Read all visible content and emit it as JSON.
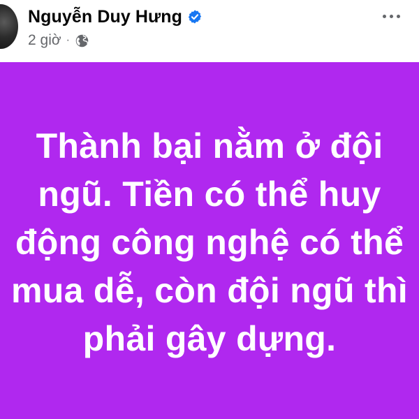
{
  "post": {
    "author_name": "Nguyễn Duy Hưng",
    "time": "2 giờ",
    "separator": "·",
    "verified_icon": "verified-badge-icon",
    "privacy_icon": "globe-icon",
    "more_icon": "more-horizontal-icon",
    "colors": {
      "background": "#b028ef",
      "text": "#ffffff",
      "verified": "#1877f2",
      "meta": "#65676b"
    },
    "status_lines": [
      "Thành bại nằm ở đội",
      "ngũ. Tiền có thể huy",
      "động công nghệ có thể",
      "mua dễ, còn đội ngũ thì",
      "phải gây dựng."
    ]
  }
}
